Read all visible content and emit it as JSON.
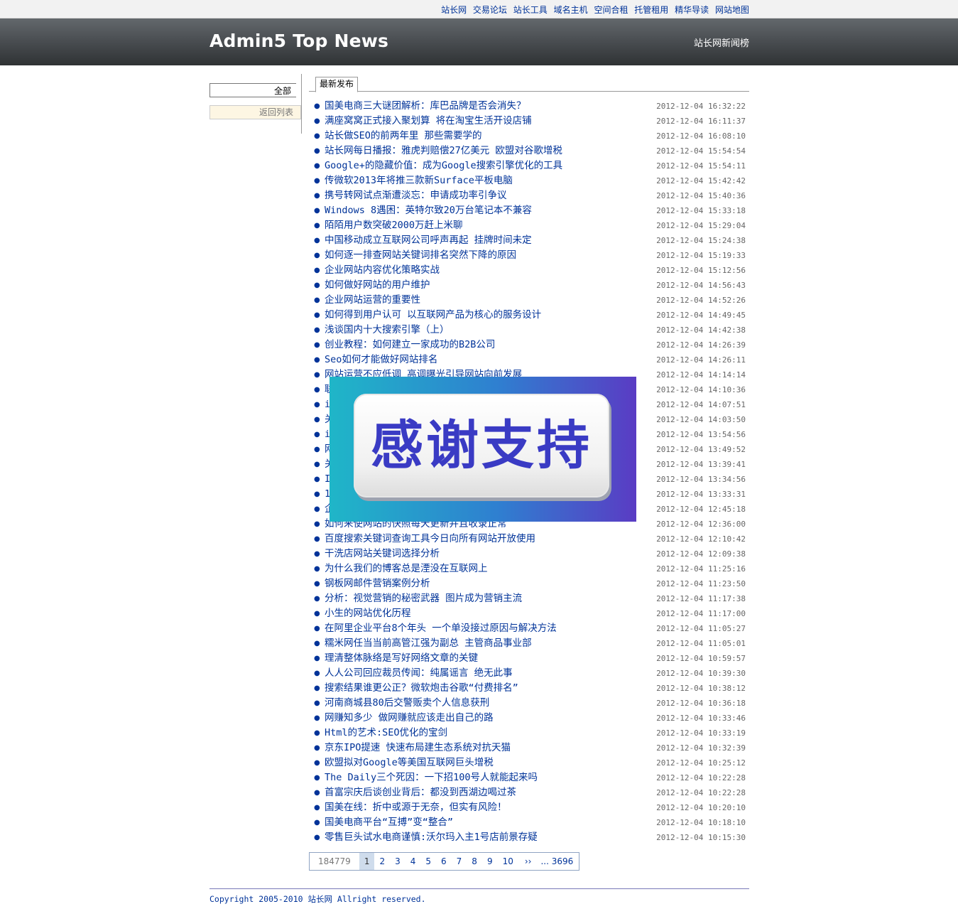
{
  "top_links": [
    "站长网",
    "交易论坛",
    "站长工具",
    "域名主机",
    "空间合租",
    "托管租用",
    "精华导读",
    "网站地图"
  ],
  "header": {
    "title": "Admin5 Top News",
    "right_label": "站长网新闻榜"
  },
  "sidebar": {
    "all_label": "全部",
    "back_label": "返回列表"
  },
  "main": {
    "tab_label": "最新发布"
  },
  "news": [
    {
      "title": "国美电商三大谜团解析：库巴品牌是否会消失？",
      "time": "2012-12-04 16:32:22"
    },
    {
      "title": "满座窝窝正式接入聚划算 将在淘宝生活开设店铺",
      "time": "2012-12-04 16:11:37"
    },
    {
      "title": "站长做SEO的前两年里 那些需要学的",
      "time": "2012-12-04 16:08:10"
    },
    {
      "title": "站长网每日播报：雅虎判赔偿27亿美元 欧盟对谷歌增税",
      "time": "2012-12-04 15:54:54"
    },
    {
      "title": "Google+的隐藏价值：成为Google搜索引擎优化的工具",
      "time": "2012-12-04 15:54:11"
    },
    {
      "title": "传微软2013年将推三款新Surface平板电脑",
      "time": "2012-12-04 15:42:42"
    },
    {
      "title": "携号转网试点渐遭淡忘：申请成功率引争议",
      "time": "2012-12-04 15:40:36"
    },
    {
      "title": "Windows 8遇困：英特尔致20万台笔记本不兼容",
      "time": "2012-12-04 15:33:18"
    },
    {
      "title": "陌陌用户数突破2000万赶上米聊",
      "time": "2012-12-04 15:29:04"
    },
    {
      "title": "中国移动成立互联网公司呼声再起 挂牌时间未定",
      "time": "2012-12-04 15:24:38"
    },
    {
      "title": "如何逐一排查网站关键词排名突然下降的原因",
      "time": "2012-12-04 15:19:33"
    },
    {
      "title": "企业网站内容优化策略实战",
      "time": "2012-12-04 15:12:56"
    },
    {
      "title": "如何做好网站的用户维护",
      "time": "2012-12-04 14:56:43"
    },
    {
      "title": "企业网站运营的重要性",
      "time": "2012-12-04 14:52:26"
    },
    {
      "title": "如何得到用户认可 以互联网产品为核心的服务设计",
      "time": "2012-12-04 14:49:45"
    },
    {
      "title": "浅谈国内十大搜索引擎（上）",
      "time": "2012-12-04 14:42:38"
    },
    {
      "title": "创业教程：如何建立一家成功的B2B公司",
      "time": "2012-12-04 14:26:39"
    },
    {
      "title": "Seo如何才能做好网站排名",
      "time": "2012-12-04 14:26:11"
    },
    {
      "title": "网站运营不应低调 高调曝光引导网站向前发展",
      "time": "2012-12-04 14:14:14"
    },
    {
      "title": "联",
      "time": "2012-12-04 14:10:36"
    },
    {
      "title": "i",
      "time": "2012-12-04 14:07:51"
    },
    {
      "title": "关",
      "time": "2012-12-04 14:03:50"
    },
    {
      "title": "i",
      "time": "2012-12-04 13:54:56"
    },
    {
      "title": "网",
      "time": "2012-12-04 13:49:52"
    },
    {
      "title": "关",
      "time": "2012-12-04 13:39:41"
    },
    {
      "title": "I",
      "time": "2012-12-04 13:34:56"
    },
    {
      "title": "1",
      "time": "2012-12-04 13:33:31"
    },
    {
      "title": "企",
      "time": "2012-12-04 12:45:18"
    },
    {
      "title": "如何来使网站的快照每天更新并且收录正常",
      "time": "2012-12-04 12:36:00"
    },
    {
      "title": "百度搜索关键词查询工具今日向所有网站开放使用",
      "time": "2012-12-04 12:10:42"
    },
    {
      "title": "干洗店网站关键词选择分析",
      "time": "2012-12-04 12:09:38"
    },
    {
      "title": "为什么我们的博客总是湮没在互联网上",
      "time": "2012-12-04 11:25:16"
    },
    {
      "title": "钢板网邮件营销案例分析",
      "time": "2012-12-04 11:23:50"
    },
    {
      "title": "分析：视觉营销的秘密武器 图片成为营销主流",
      "time": "2012-12-04 11:17:38"
    },
    {
      "title": "小生的网站优化历程",
      "time": "2012-12-04 11:17:00"
    },
    {
      "title": "在阿里企业平台8个年头 一个单没接过原因与解决方法",
      "time": "2012-12-04 11:05:27"
    },
    {
      "title": "糯米网任当当前高管江强为副总 主管商品事业部",
      "time": "2012-12-04 11:05:01"
    },
    {
      "title": "理清整体脉络是写好网络文章的关键",
      "time": "2012-12-04 10:59:57"
    },
    {
      "title": "人人公司回应裁员传闻：纯属谣言 绝无此事",
      "time": "2012-12-04 10:39:30"
    },
    {
      "title": "搜索结果谁更公正？微软炮击谷歌“付费排名”",
      "time": "2012-12-04 10:38:12"
    },
    {
      "title": "河南商城县80后交警贩卖个人信息获刑",
      "time": "2012-12-04 10:36:18"
    },
    {
      "title": "网赚知多少 做网赚就应该走出自己的路",
      "time": "2012-12-04 10:33:46"
    },
    {
      "title": "Html的艺术:SEO优化的宝剑",
      "time": "2012-12-04 10:33:19"
    },
    {
      "title": "京东IPO提速 快速布局建生态系统对抗天猫",
      "time": "2012-12-04 10:32:39"
    },
    {
      "title": "欧盟拟对Google等美国互联网巨头增税",
      "time": "2012-12-04 10:25:12"
    },
    {
      "title": "The Daily三个死因：一下招100号人就能起来吗",
      "time": "2012-12-04 10:22:28"
    },
    {
      "title": "首富宗庆后谈创业背后：都没到西湖边喝过茶",
      "time": "2012-12-04 10:22:28"
    },
    {
      "title": "国美在线：折中或源于无奈，但实有风险！",
      "time": "2012-12-04 10:20:10"
    },
    {
      "title": "国美电商平台“互搏”变“整合”",
      "time": "2012-12-04 10:18:10"
    },
    {
      "title": "零售巨头试水电商谨慎:沃尔玛入主1号店前景存疑",
      "time": "2012-12-04 10:15:30"
    }
  ],
  "pager": {
    "total": "184779",
    "current": "1",
    "pages": [
      "2",
      "3",
      "4",
      "5",
      "6",
      "7",
      "8",
      "9",
      "10"
    ],
    "next": "››",
    "last": "... 3696"
  },
  "footer": {
    "text": "Copyright 2005-2010 站长网 Allright reserved."
  },
  "overlay": {
    "text": "感谢支持"
  }
}
